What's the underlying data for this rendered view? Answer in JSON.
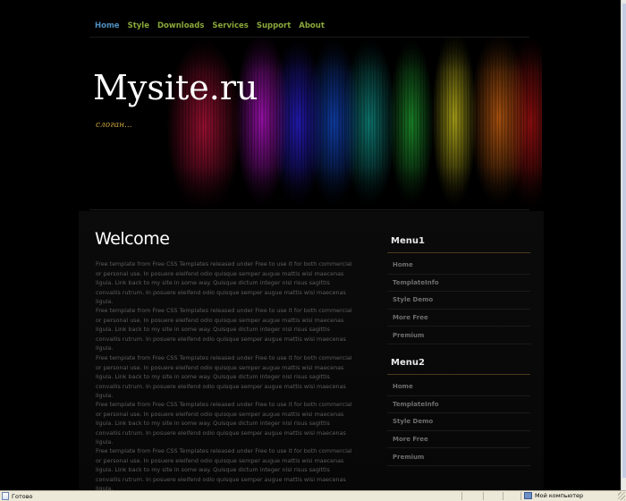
{
  "nav": {
    "items": [
      "Home",
      "Style",
      "Downloads",
      "Services",
      "Support",
      "About"
    ],
    "active": "Home"
  },
  "header": {
    "site_title": "Mysite.ru",
    "slogan": "слоган..."
  },
  "main": {
    "heading": "Welcome",
    "paragraphs": [
      "Free template from Free CSS Templates released under Free to use it for both commercial or personal use. In posuere eleifend odio quisque semper augue mattis wisi maecenas ligula. Link back to my site in some way. Quisque dictum integer nisl risus sagittis convallis rutrum. In posuere eleifend odio quisque semper augue mattis wisi maecenas ligula.",
      "Free template from Free CSS Templates released under Free to use it for both commercial or personal use. In posuere eleifend odio quisque semper augue mattis wisi maecenas ligula. Link back to my site in some way. Quisque dictum integer nisl risus sagittis convallis rutrum. In posuere eleifend odio quisque semper augue mattis wisi maecenas ligula.",
      "Free template from Free CSS Templates released under Free to use it for both commercial or personal use. In posuere eleifend odio quisque semper augue mattis wisi maecenas ligula. Link back to my site in some way. Quisque dictum integer nisl risus sagittis convallis rutrum. In posuere eleifend odio quisque semper augue mattis wisi maecenas ligula.",
      "Free template from Free CSS Templates released under Free to use it for both commercial or personal use. In posuere eleifend odio quisque semper augue mattis wisi maecenas ligula. Link back to my site in some way. Quisque dictum integer nisl risus sagittis convallis rutrum. In posuere eleifend odio quisque semper augue mattis wisi maecenas ligula.",
      "Free template from Free CSS Templates released under Free to use it for both commercial or personal use. In posuere eleifend odio quisque semper augue mattis wisi maecenas ligula. Link back to my site in some way. Quisque dictum integer nisl risus sagittis convallis rutrum. In posuere eleifend odio quisque semper augue mattis wisi maecenas ligula."
    ]
  },
  "sidebar": {
    "menu1": {
      "title": "Menu1",
      "items": [
        "Home",
        "TemplateInfo",
        "Style Demo",
        "More Free",
        "Premium"
      ]
    },
    "menu2": {
      "title": "Menu2",
      "items": [
        "Home",
        "TemplateInfo",
        "Style Demo",
        "More Free",
        "Premium"
      ]
    }
  },
  "statusbar": {
    "left_text": "Готово",
    "right_text": "Мой компьютер"
  },
  "colors": {
    "background": "#000000",
    "nav_link": "#8aa83a",
    "nav_active": "#4f8fc0",
    "slogan": "#c7a23a",
    "body_text": "#5c5c5c"
  }
}
